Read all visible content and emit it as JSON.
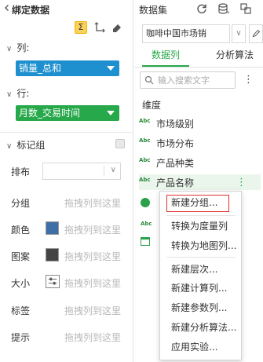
{
  "left_panel": {
    "title": "绑定数据",
    "tools": {
      "sigma": "Σ"
    },
    "columns_label": "列:",
    "columns_value": "销量_总和",
    "rows_label": "行:",
    "rows_value": "月数_交易时间",
    "mark_group_label": "标记组",
    "layout_label": "排布",
    "props": [
      {
        "label": "分组",
        "hint": "拖拽列到这里"
      },
      {
        "label": "颜色",
        "hint": "拖拽列到这里"
      },
      {
        "label": "图案",
        "hint": "拖拽列到这里"
      },
      {
        "label": "大小",
        "hint": "拖拽列到这里"
      },
      {
        "label": "标签",
        "hint": "拖拽列到这里"
      },
      {
        "label": "提示",
        "hint": "拖拽列到这里"
      }
    ],
    "colors": {
      "columns_pill": "#1e8fcf",
      "rows_pill": "#27a84a",
      "color_swatch": "#3e6fa6",
      "pattern_swatch": "#444444"
    }
  },
  "right_panel": {
    "title": "数据集",
    "icons": [
      "refresh-icon",
      "dataset-stack-icon",
      "switch-dataset-icon"
    ],
    "dataset_value": "咖啡中国市场销",
    "tabs": [
      {
        "label": "数据列",
        "active": true
      },
      {
        "label": "分析算法",
        "active": false
      }
    ],
    "search_placeholder": "输入搜索文字",
    "dimension_label": "维度",
    "abc": "Abc",
    "fields": [
      {
        "name": "市场级别"
      },
      {
        "name": "市场分布"
      },
      {
        "name": "产品种类"
      },
      {
        "name": "产品名称"
      }
    ],
    "accent": "#27a84a"
  },
  "context_menu": {
    "items": [
      "新建分组...",
      "转换为度量列",
      "转换为地图列...",
      "新建层次...",
      "新建计算列...",
      "新建参数列...",
      "新建分析算法...",
      "应用实验..."
    ],
    "highlight_color": "#e0302a"
  }
}
